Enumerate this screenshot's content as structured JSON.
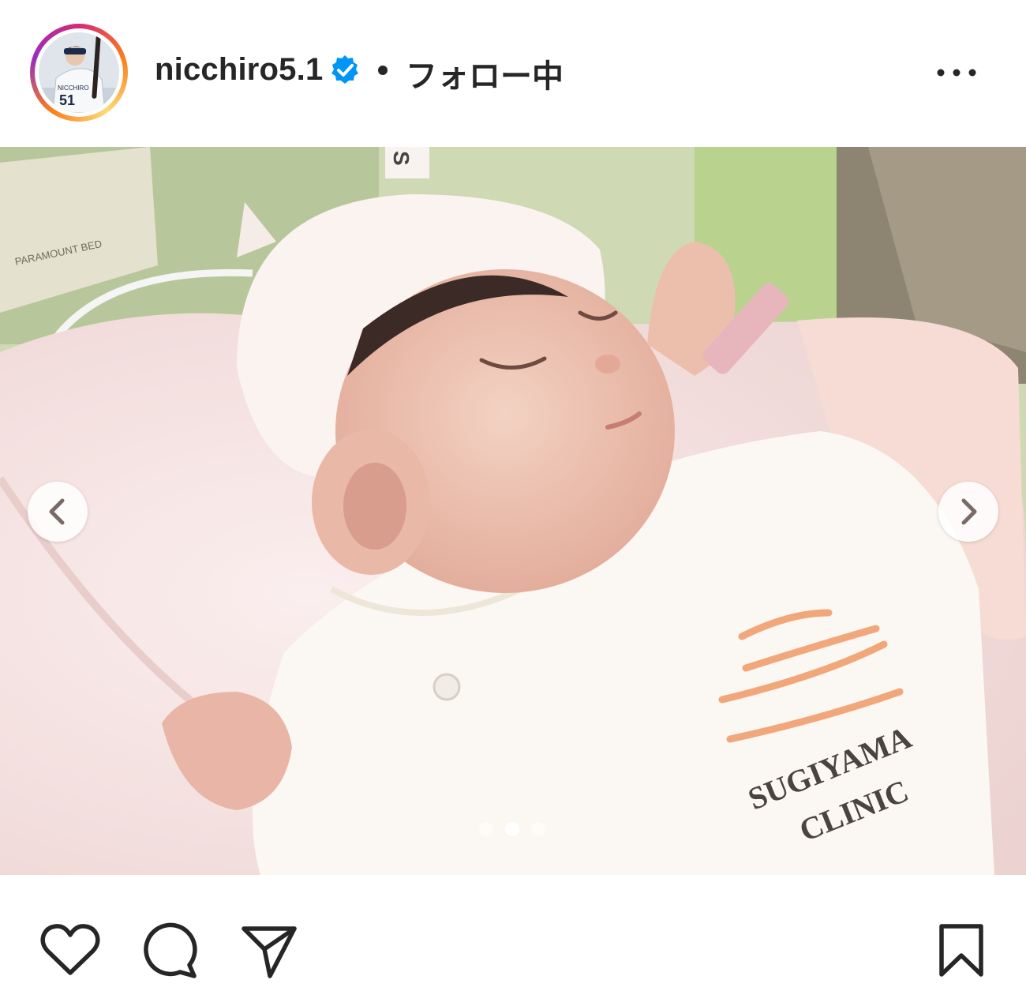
{
  "header": {
    "username": "nicchiro5.1",
    "separator": "•",
    "follow_label": "フォロー中",
    "more_icon": "more-horizontal-icon"
  },
  "avatar": {
    "jersey_number": "51",
    "jersey_text": "NICCHIRO"
  },
  "photo": {
    "clinic_line1": "SUGIYAMA",
    "clinic_line2": "CLINIC",
    "hat_tag": "S",
    "bed_label": "PARAMOUNT BED"
  },
  "carousel": {
    "current": 2,
    "total": 3
  },
  "actions": {
    "like_icon": "heart-icon",
    "comment_icon": "comment-icon",
    "share_icon": "send-icon",
    "save_icon": "bookmark-icon"
  },
  "colors": {
    "verified": "#0095f6",
    "text": "#262626"
  }
}
